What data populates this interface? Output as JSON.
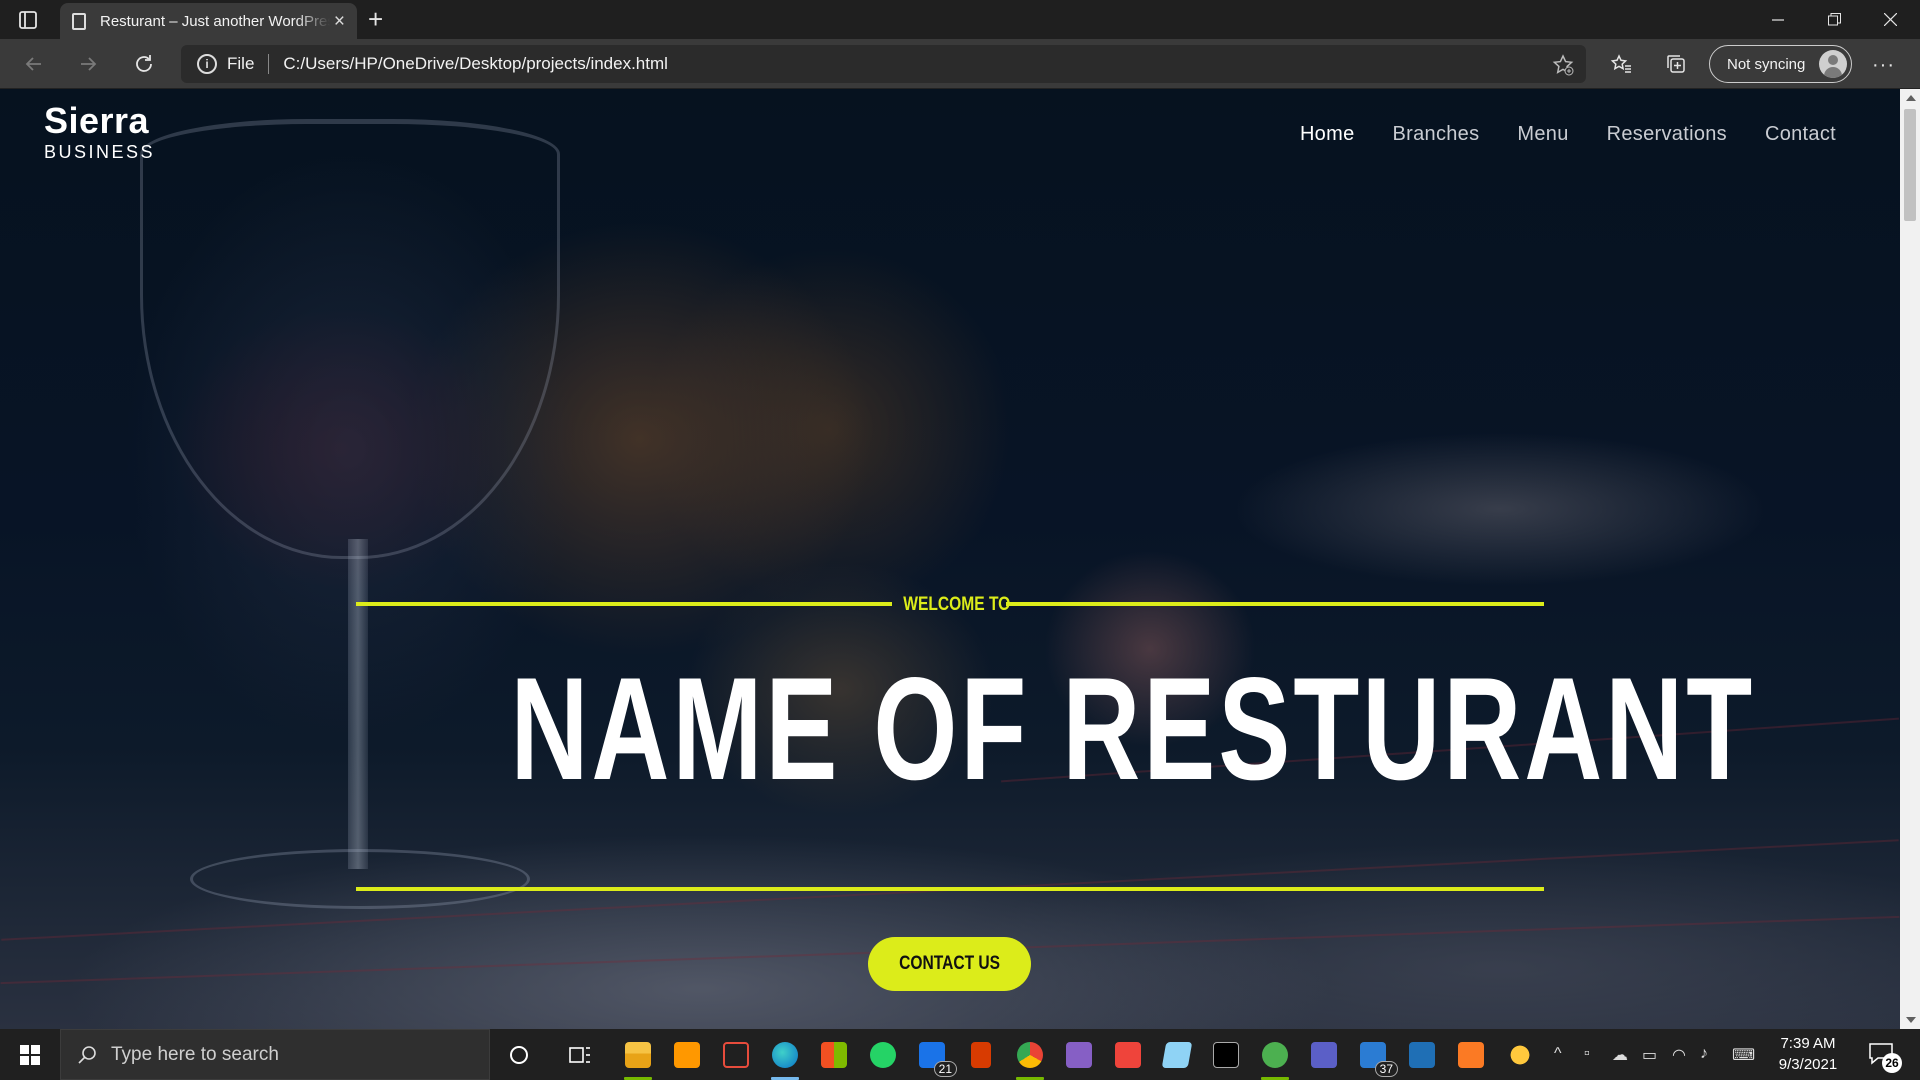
{
  "browser": {
    "tab_title": "Resturant – Just another WordPress site",
    "address_scheme": "File",
    "address_url": "C:/Users/HP/OneDrive/Desktop/projects/index.html",
    "profile_label": "Not syncing"
  },
  "site": {
    "logo_line1": "Sierra",
    "logo_line2": "BUSINESS",
    "nav": [
      {
        "label": "Home",
        "active": true
      },
      {
        "label": "Branches"
      },
      {
        "label": "Menu"
      },
      {
        "label": "Reservations"
      },
      {
        "label": "Contact"
      }
    ],
    "hero": {
      "kicker": "WELCOME TO",
      "title": "NAME OF RESTURANT",
      "cta_label": "CONTACT US"
    },
    "accent_color": "#dcec1a"
  },
  "taskbar": {
    "search_placeholder": "Type here to search",
    "apps": [
      "task-view",
      "file-explorer",
      "sublime-text",
      "snip-sketch",
      "edge",
      "microsoft-store",
      "whatsapp",
      "mail",
      "office",
      "chrome",
      "visual-studio",
      "anydesk",
      "notepad",
      "terminal",
      "utorrent",
      "teams",
      "word-doc",
      "devexpress",
      "xampp"
    ],
    "mail_badge": "21",
    "doc_badge": "37",
    "time": "7:39 AM",
    "date": "9/3/2021",
    "notifications": "26"
  }
}
